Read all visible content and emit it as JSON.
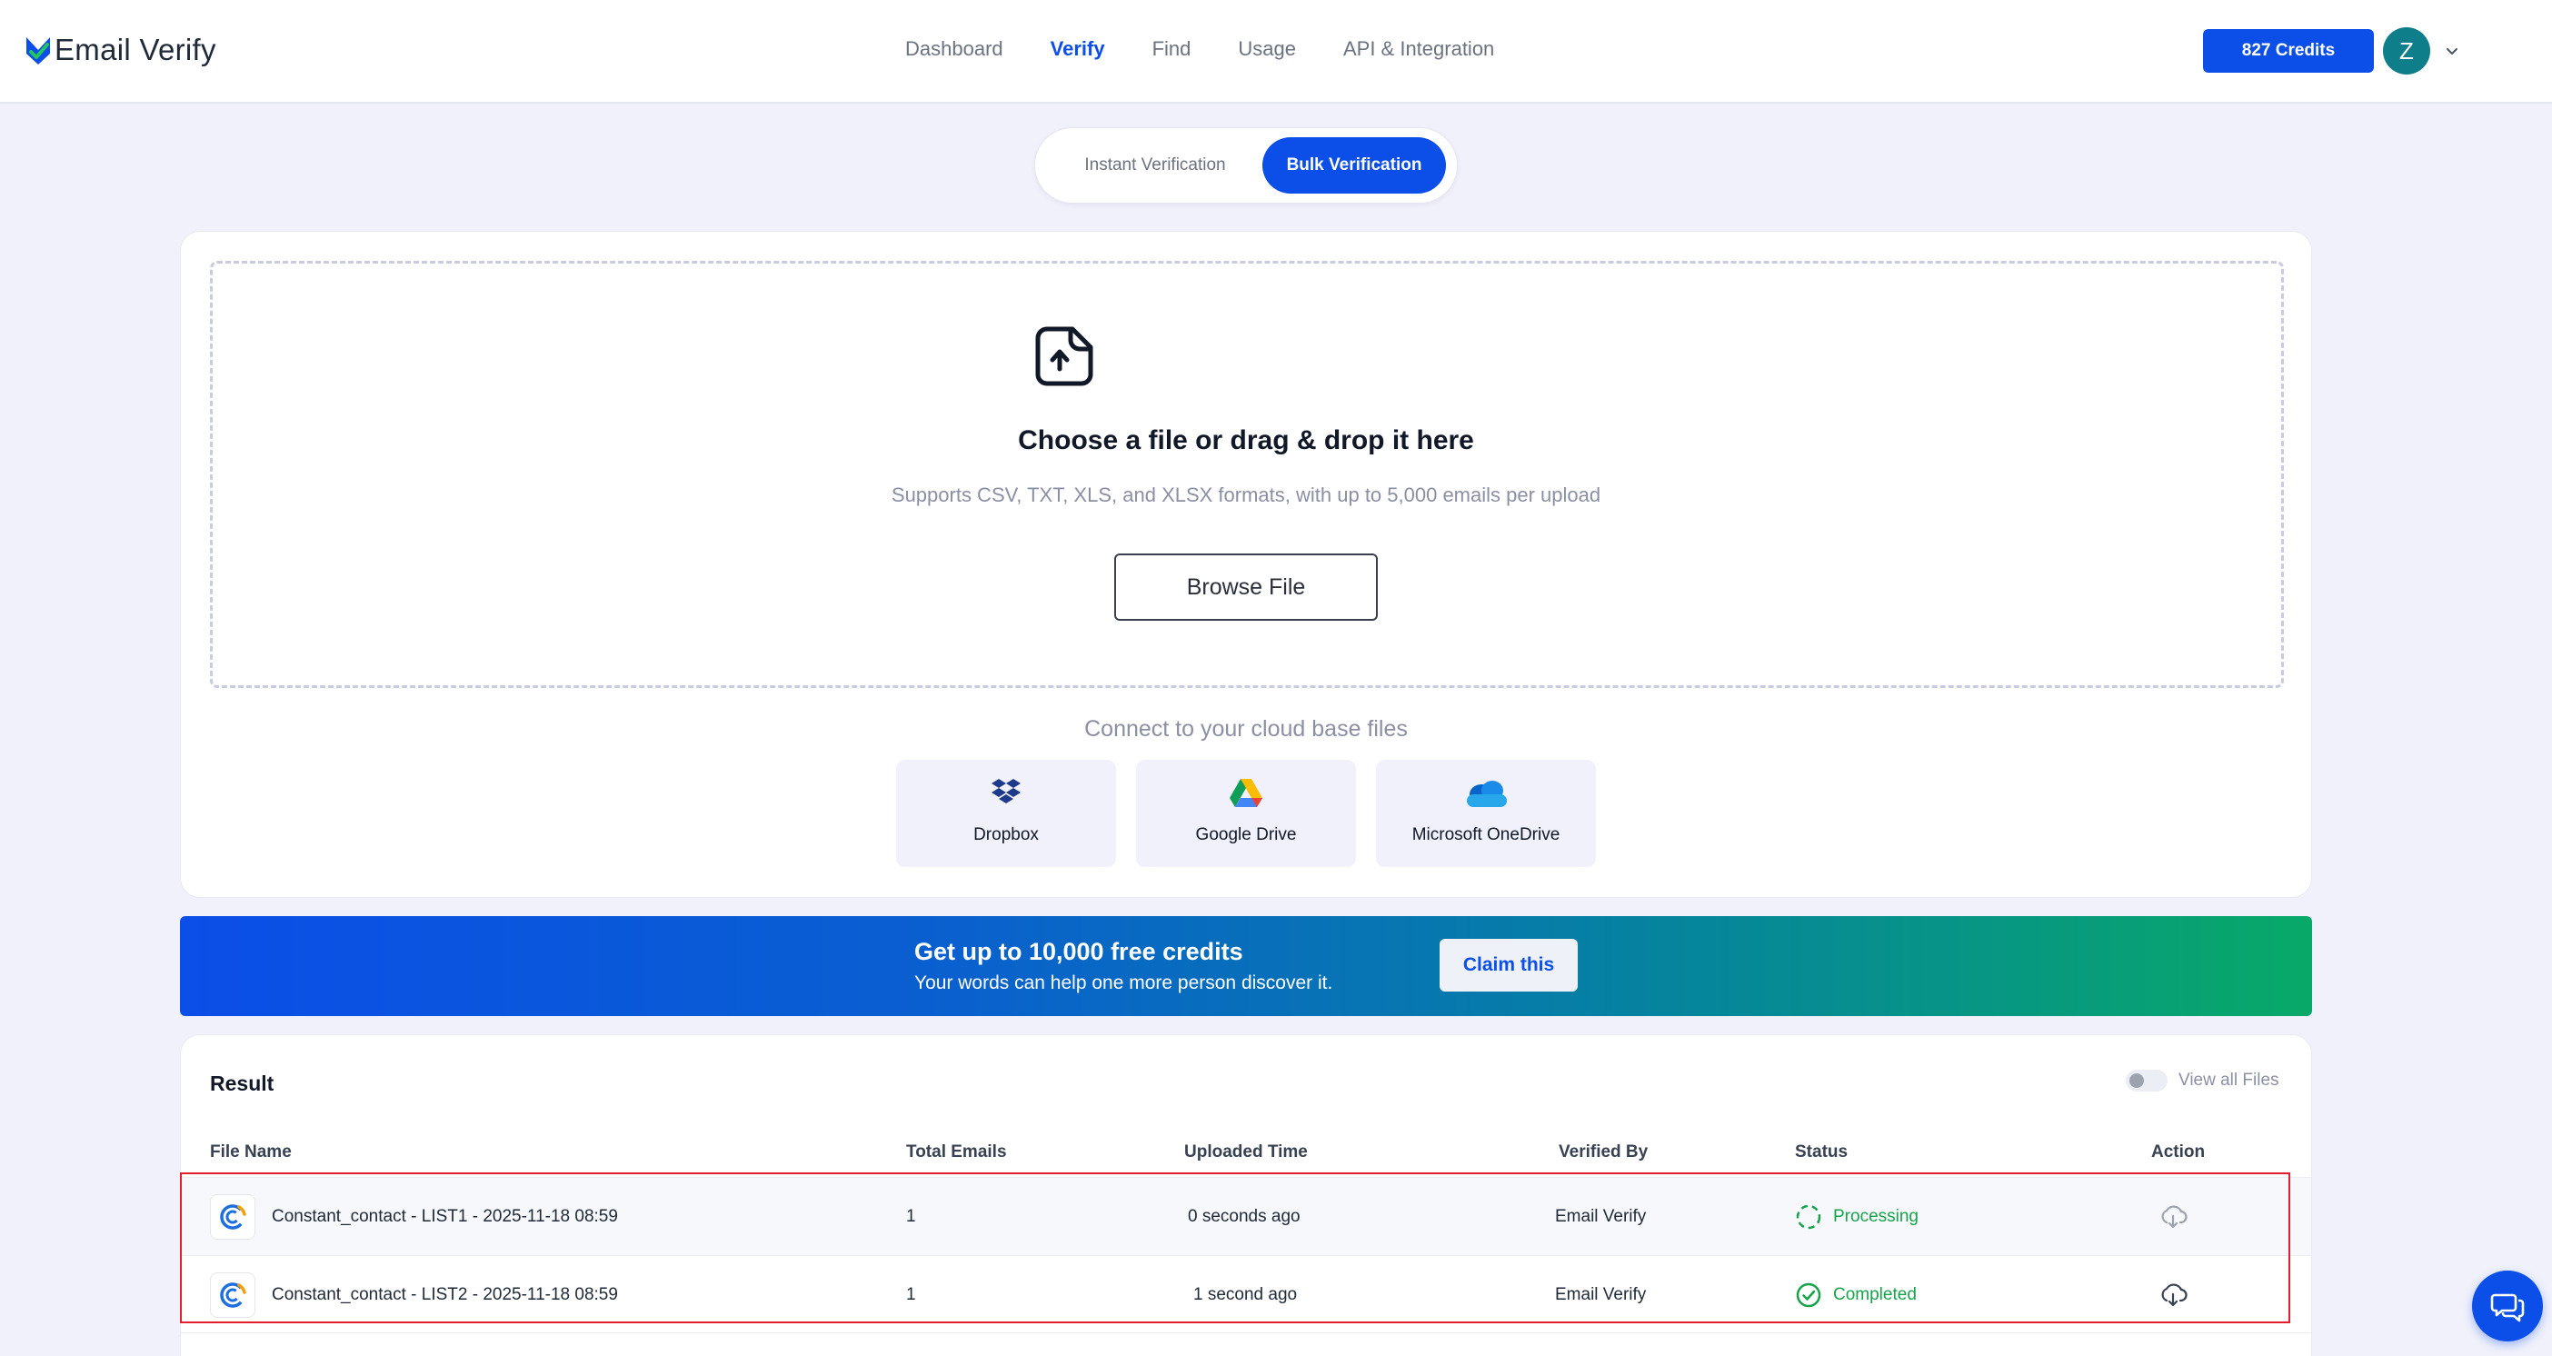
{
  "brand": {
    "name": "Email Verify"
  },
  "nav": {
    "items": [
      {
        "label": "Dashboard"
      },
      {
        "label": "Verify"
      },
      {
        "label": "Find"
      },
      {
        "label": "Usage"
      },
      {
        "label": "API & Integration"
      }
    ],
    "active": "Verify"
  },
  "account": {
    "credits_label": "827 Credits",
    "avatar_initial": "Z"
  },
  "tabs": {
    "instant": "Instant Verification",
    "bulk": "Bulk Verification",
    "active": "Bulk Verification"
  },
  "upload": {
    "title": "Choose a file or drag & drop it here",
    "subtitle": "Supports CSV, TXT, XLS, and XLSX formats, with up to 5,000 emails per upload",
    "browse_label": "Browse File",
    "cloud_title": "Connect to your cloud base files",
    "cloud_options": [
      {
        "label": "Dropbox",
        "icon": "dropbox-icon"
      },
      {
        "label": "Google Drive",
        "icon": "google-drive-icon"
      },
      {
        "label": "Microsoft OneDrive",
        "icon": "onedrive-icon"
      }
    ]
  },
  "promo": {
    "title": "Get up to 10,000 free credits",
    "subtitle": "Your words can help one more person discover it.",
    "cta": "Claim this"
  },
  "results": {
    "title": "Result",
    "view_all_label": "View all Files",
    "columns": [
      "File Name",
      "Total Emails",
      "Uploaded Time",
      "Verified By",
      "Status",
      "Action"
    ],
    "rows": [
      {
        "file_name": "Constant_contact - LIST1 - 2025-11-18 08:59",
        "total_emails": "1",
        "uploaded": "0 seconds ago",
        "verified_by": "Email Verify",
        "status": "Processing"
      },
      {
        "file_name": "Constant_contact - LIST2 - 2025-11-18 08:59",
        "total_emails": "1",
        "uploaded": "1 second ago",
        "verified_by": "Email Verify",
        "status": "Completed"
      }
    ]
  },
  "colors": {
    "accent": "#0b4ee8",
    "success": "#16a34a",
    "highlight": "#e11d2e"
  }
}
